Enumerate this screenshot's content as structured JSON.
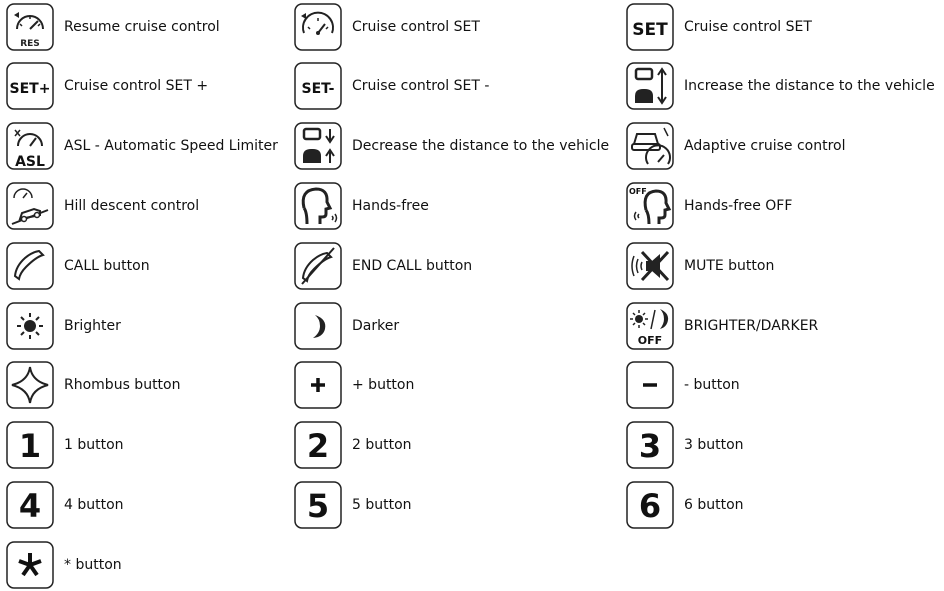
{
  "items": [
    {
      "label": "Resume cruise control",
      "icon": "resume-cruise-icon",
      "badge": "RES"
    },
    {
      "label": "Cruise control SET",
      "icon": "cruise-set-gauge-icon"
    },
    {
      "label": "Cruise control SET",
      "icon": "set-text-icon",
      "badge": "SET"
    },
    {
      "label": "Cruise control SET +",
      "icon": "set-plus-icon",
      "badge": "SET+"
    },
    {
      "label": "Cruise control SET -",
      "icon": "set-minus-icon",
      "badge": "SET-"
    },
    {
      "label": "Increase the distance to the vehicle",
      "icon": "increase-distance-icon"
    },
    {
      "label": "ASL - Automatic Speed Limiter",
      "icon": "asl-icon",
      "badge": "ASL"
    },
    {
      "label": "Decrease the distance to the vehicle",
      "icon": "decrease-distance-icon"
    },
    {
      "label": "Adaptive cruise control",
      "icon": "adaptive-cruise-icon"
    },
    {
      "label": "Hill descent control",
      "icon": "hill-descent-icon"
    },
    {
      "label": "Hands-free",
      "icon": "hands-free-icon"
    },
    {
      "label": "Hands-free OFF",
      "icon": "hands-free-off-icon",
      "badge": "OFF"
    },
    {
      "label": "CALL button",
      "icon": "call-icon"
    },
    {
      "label": "END CALL button",
      "icon": "end-call-icon"
    },
    {
      "label": "MUTE button",
      "icon": "mute-icon"
    },
    {
      "label": "Brighter",
      "icon": "brighter-icon"
    },
    {
      "label": "Darker",
      "icon": "darker-icon"
    },
    {
      "label": "BRIGHTER/DARKER",
      "icon": "brighter-darker-off-icon",
      "badge": "OFF"
    },
    {
      "label": "Rhombus button",
      "icon": "rhombus-icon"
    },
    {
      "label": "+ button",
      "icon": "plus-icon"
    },
    {
      "label": "- button",
      "icon": "minus-icon"
    },
    {
      "label": "1 button",
      "icon": "digit-1-icon",
      "badge": "1"
    },
    {
      "label": "2 button",
      "icon": "digit-2-icon",
      "badge": "2"
    },
    {
      "label": "3 button",
      "icon": "digit-3-icon",
      "badge": "3"
    },
    {
      "label": "4 button",
      "icon": "digit-4-icon",
      "badge": "4"
    },
    {
      "label": "5 button",
      "icon": "digit-5-icon",
      "badge": "5"
    },
    {
      "label": "6 button",
      "icon": "digit-6-icon",
      "badge": "6"
    },
    {
      "label": "* button",
      "icon": "asterisk-icon"
    }
  ]
}
